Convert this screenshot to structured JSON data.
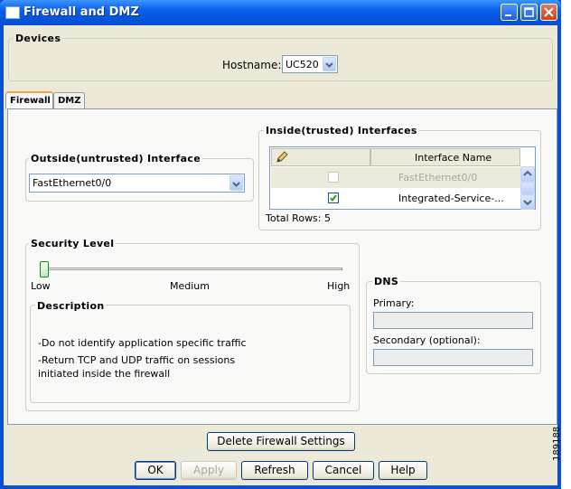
{
  "window": {
    "title": "Firewall and DMZ"
  },
  "devices": {
    "group_label": "Devices",
    "hostname_label": "Hostname:",
    "hostname_value": "UC520"
  },
  "tabs": [
    {
      "label": "Firewall",
      "active": true
    },
    {
      "label": "DMZ",
      "active": false
    }
  ],
  "outside": {
    "group_label": "Outside(untrusted) Interface",
    "value": "FastEthernet0/0"
  },
  "inside": {
    "group_label": "Inside(trusted) Interfaces",
    "column_header": "Interface Name",
    "rows": [
      {
        "name": "FastEthernet0/0",
        "checked": false,
        "enabled": false
      },
      {
        "name": "Integrated-Service-...",
        "checked": true,
        "enabled": true
      }
    ],
    "total_rows": "Total Rows: 5"
  },
  "security": {
    "group_label": "Security Level",
    "low": "Low",
    "medium": "Medium",
    "high": "High",
    "level": 0,
    "description_label": "Description",
    "description_lines": [
      "-Do not identify application specific traffic",
      "-Return TCP and UDP traffic on sessions",
      "initiated inside the firewall"
    ]
  },
  "dns": {
    "group_label": "DNS",
    "primary_label": "Primary:",
    "primary_value": "",
    "secondary_label": "Secondary (optional):",
    "secondary_value": ""
  },
  "buttons": {
    "delete": "Delete Firewall Settings",
    "ok": "OK",
    "apply": "Apply",
    "refresh": "Refresh",
    "cancel": "Cancel",
    "help": "Help"
  },
  "side_label": "189188",
  "colors": {
    "title_bar": "#0a5fe8",
    "window_bg": "#ece9d8",
    "tab_active_accent": "#f9a33a"
  }
}
